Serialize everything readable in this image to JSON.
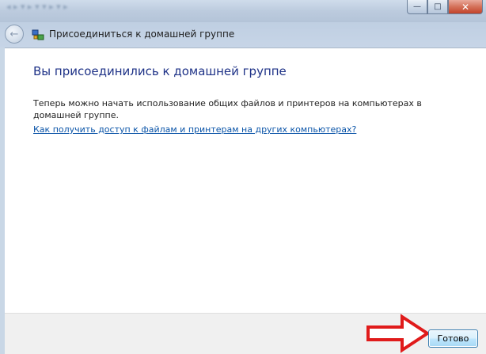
{
  "window": {
    "title": "Присоединиться к домашней группе",
    "buttons": {
      "minimize": "—",
      "maximize": "□",
      "close": "✕"
    }
  },
  "nav": {
    "back_glyph": "←",
    "icon": "homegroup-icon"
  },
  "content": {
    "heading": "Вы присоединились к домашней группе",
    "body": "Теперь можно начать использование общих файлов и принтеров на компьютерах в домашней группе.",
    "link": "Как получить доступ к файлам и принтерам на других компьютерах?"
  },
  "footer": {
    "done_label": "Готово"
  },
  "colors": {
    "heading": "#1e3287",
    "link": "#0a54a8",
    "arrow": "#e01b1b"
  }
}
